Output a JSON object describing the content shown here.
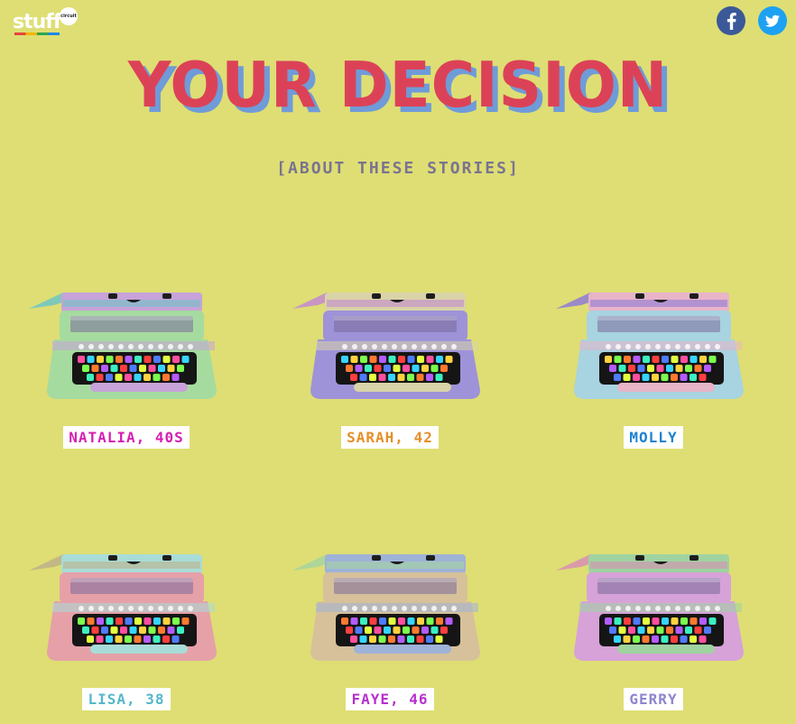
{
  "brand": {
    "logo_text": "stuff",
    "logo_badge": "circuit"
  },
  "social": {
    "facebook_icon": "facebook-icon",
    "twitter_icon": "twitter-icon",
    "facebook_color": "#3b5998",
    "twitter_color": "#1da1f2"
  },
  "title": "YOUR DECISION",
  "about_link": "[ABOUT THESE STORIES]",
  "stories": [
    {
      "name": "NATALIA, 40S",
      "color": "#d41fb2",
      "body": "#a6dba0",
      "frame": "#c7a3d9",
      "paper": "#6ec5c5"
    },
    {
      "name": "SARAH, 42",
      "color": "#e58f28",
      "body": "#9e93d8",
      "frame": "#d9d3a8",
      "paper": "#c38bd0"
    },
    {
      "name": "MOLLY",
      "color": "#1e82d0",
      "body": "#a8d3e0",
      "frame": "#e8b4c8",
      "paper": "#8f7bd6"
    },
    {
      "name": "LISA, 38",
      "color": "#55b7c9",
      "body": "#e6a0a8",
      "frame": "#a8dcd8",
      "paper": "#bcb28a"
    },
    {
      "name": "FAYE, 46",
      "color": "#b82fd0",
      "body": "#d7c19a",
      "frame": "#9fb2d8",
      "paper": "#a5d5a0"
    },
    {
      "name": "GERRY",
      "color": "#8f86cf",
      "body": "#d6a2d8",
      "frame": "#9fd3a0",
      "paper": "#d88fb4"
    }
  ]
}
